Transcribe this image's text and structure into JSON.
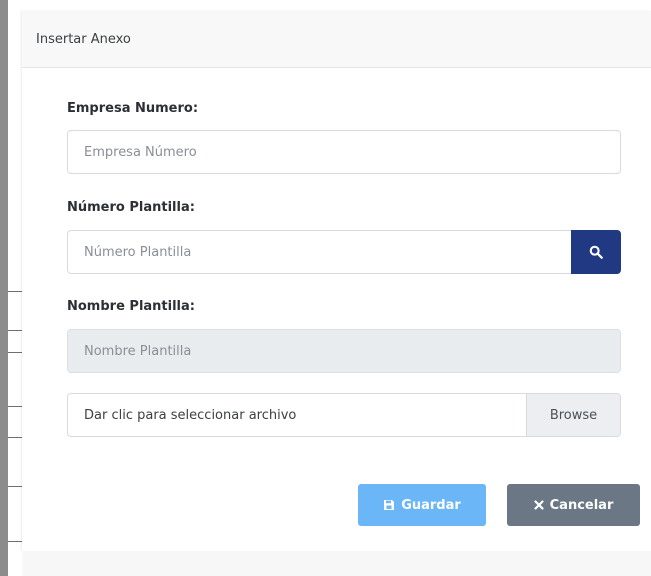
{
  "modal": {
    "title": "Insertar Anexo"
  },
  "form": {
    "empresa_label": "Empresa Numero:",
    "empresa_placeholder": "Empresa Número",
    "empresa_value": "",
    "plantilla_label": "Número Plantilla:",
    "plantilla_placeholder": "Número Plantilla",
    "plantilla_value": "",
    "nombre_label": "Nombre Plantilla:",
    "nombre_placeholder": "Nombre Plantilla",
    "nombre_value": "",
    "file_text": "Dar clic para seleccionar archivo",
    "file_browse": "Browse"
  },
  "buttons": {
    "save_label": "Guardar",
    "cancel_label": "Cancelar"
  },
  "icons": {
    "search": "search-icon",
    "save": "floppy-disk-icon",
    "cancel": "close-icon"
  },
  "colors": {
    "search_button": "#213882",
    "save_button": "#6ab6f6",
    "cancel_button": "#6b7784",
    "readonly_field": "#e9ecef"
  }
}
